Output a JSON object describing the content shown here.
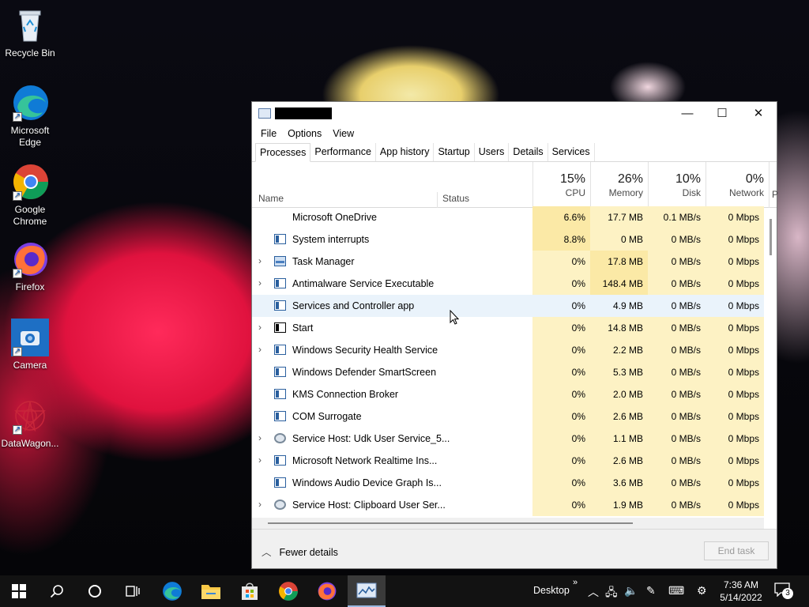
{
  "desktop_icons": [
    {
      "label": "Recycle Bin",
      "icon": "recycle-bin-icon"
    },
    {
      "label": "Microsoft Edge",
      "icon": "edge-icon"
    },
    {
      "label": "Google Chrome",
      "icon": "chrome-icon"
    },
    {
      "label": "Firefox",
      "icon": "firefox-icon"
    },
    {
      "label": "Camera",
      "icon": "camera-icon"
    },
    {
      "label": "DataWagon...",
      "icon": "datawagon-icon"
    }
  ],
  "window": {
    "menu": [
      "File",
      "Options",
      "View"
    ],
    "tabs": [
      "Processes",
      "Performance",
      "App history",
      "Startup",
      "Users",
      "Details",
      "Services"
    ],
    "active_tab": "Processes",
    "columns": {
      "name": "Name",
      "status": "Status",
      "cpu": {
        "pct": "15%",
        "label": "CPU"
      },
      "memory": {
        "pct": "26%",
        "label": "Memory"
      },
      "disk": {
        "pct": "10%",
        "label": "Disk"
      },
      "network": {
        "pct": "0%",
        "label": "Network"
      },
      "overflow": "P"
    },
    "processes": [
      {
        "name": "Microsoft OneDrive",
        "cpu": "6.6%",
        "memory": "17.7 MB",
        "disk": "0.1 MB/s",
        "network": "0 Mbps"
      },
      {
        "name": "System interrupts",
        "cpu": "8.8%",
        "memory": "0 MB",
        "disk": "0 MB/s",
        "network": "0 Mbps"
      },
      {
        "name": "Task Manager",
        "cpu": "0%",
        "memory": "17.8 MB",
        "disk": "0 MB/s",
        "network": "0 Mbps"
      },
      {
        "name": "Antimalware Service Executable",
        "cpu": "0%",
        "memory": "148.4 MB",
        "disk": "0 MB/s",
        "network": "0 Mbps"
      },
      {
        "name": "Services and Controller app",
        "cpu": "0%",
        "memory": "4.9 MB",
        "disk": "0 MB/s",
        "network": "0 Mbps"
      },
      {
        "name": "Start",
        "cpu": "0%",
        "memory": "14.8 MB",
        "disk": "0 MB/s",
        "network": "0 Mbps"
      },
      {
        "name": "Windows Security Health Service",
        "cpu": "0%",
        "memory": "2.2 MB",
        "disk": "0 MB/s",
        "network": "0 Mbps"
      },
      {
        "name": "Windows Defender SmartScreen",
        "cpu": "0%",
        "memory": "5.3 MB",
        "disk": "0 MB/s",
        "network": "0 Mbps"
      },
      {
        "name": "KMS Connection Broker",
        "cpu": "0%",
        "memory": "2.0 MB",
        "disk": "0 MB/s",
        "network": "0 Mbps"
      },
      {
        "name": "COM Surrogate",
        "cpu": "0%",
        "memory": "2.6 MB",
        "disk": "0 MB/s",
        "network": "0 Mbps"
      },
      {
        "name": "Service Host: Udk User Service_5...",
        "cpu": "0%",
        "memory": "1.1 MB",
        "disk": "0 MB/s",
        "network": "0 Mbps"
      },
      {
        "name": "Microsoft Network Realtime Ins...",
        "cpu": "0%",
        "memory": "2.6 MB",
        "disk": "0 MB/s",
        "network": "0 Mbps"
      },
      {
        "name": "Windows Audio Device Graph Is...",
        "cpu": "0%",
        "memory": "3.6 MB",
        "disk": "0 MB/s",
        "network": "0 Mbps"
      },
      {
        "name": "Service Host: Clipboard User Ser...",
        "cpu": "0%",
        "memory": "1.9 MB",
        "disk": "0 MB/s",
        "network": "0 Mbps"
      }
    ],
    "footer": {
      "fewer_details": "Fewer details",
      "end_task": "End task"
    }
  },
  "taskbar": {
    "desktop_label": "Desktop",
    "time": "7:36 AM",
    "date": "5/14/2022",
    "notification_count": "3"
  }
}
